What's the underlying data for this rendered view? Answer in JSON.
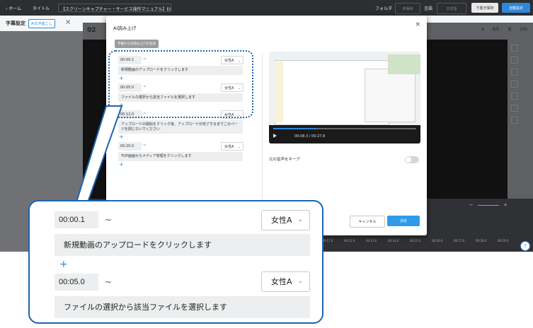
{
  "topbar": {
    "home": "ホーム",
    "title_label": "タイトル",
    "title_value": "【スクリーンキャプチャー・サービス操作マニュアル】EOアップロ",
    "folder": "フォルダ",
    "unsaved": "未保存",
    "lang_label": "言語",
    "lang_value": "日本語",
    "draft_save": "下書き保存",
    "auto_settings": "自動設定"
  },
  "subbar": {
    "label": "字幕設定",
    "ai_chip": "AI文字起こし"
  },
  "editor": {
    "scene_number": "02",
    "btn_copy": "複製",
    "btn_delete": "削除",
    "timeline_ticks": [
      "00:11.0",
      "00:12.0",
      "00:13.0",
      "00:14.0",
      "00:15.0",
      "00:16.0",
      "00:17.0",
      "00:18.0",
      "00:19.0"
    ],
    "zoom_minus": "−",
    "zoom_plus": "+"
  },
  "modal": {
    "title": "AI読み上げ",
    "generate_button": "字幕からAI読み上げを生成",
    "rows": [
      {
        "time": "00:00.1",
        "voice": "女性A",
        "text": "新規動画のアップロードをクリックします"
      },
      {
        "time": "00:05.0",
        "voice": "女性A",
        "text": "ファイルの選択から該当ファイルを選択します"
      },
      {
        "time": "00:12.0",
        "voice": "女性A",
        "text": "アップロードの開始をクリック後、アップロードが完了するまでこのページを閉じないでください"
      },
      {
        "time": "00:20.0",
        "voice": "女性A",
        "text": "TOP画面からメディア管理をクリックします"
      }
    ],
    "tilde": "~",
    "plus": "+",
    "preview_time": "00:08.3 / 00:27.8",
    "preview_progress": 0.3,
    "keep_audio_label": "元の音声をキープ",
    "keep_audio_on": false,
    "cancel": "キャンセル",
    "confirm": "決定"
  },
  "callout": {
    "rows": [
      {
        "time": "00:00.1",
        "voice": "女性A",
        "text": "新規動画のアップロードをクリックします"
      },
      {
        "time": "00:05.0",
        "voice": "女性A",
        "text": "ファイルの選択から該当ファイルを選択します"
      }
    ],
    "tilde": "~",
    "plus": "+"
  },
  "colors": {
    "accent": "#2f87d9",
    "callout_border": "#1d65b0",
    "confirm_button": "#2f9be9"
  }
}
